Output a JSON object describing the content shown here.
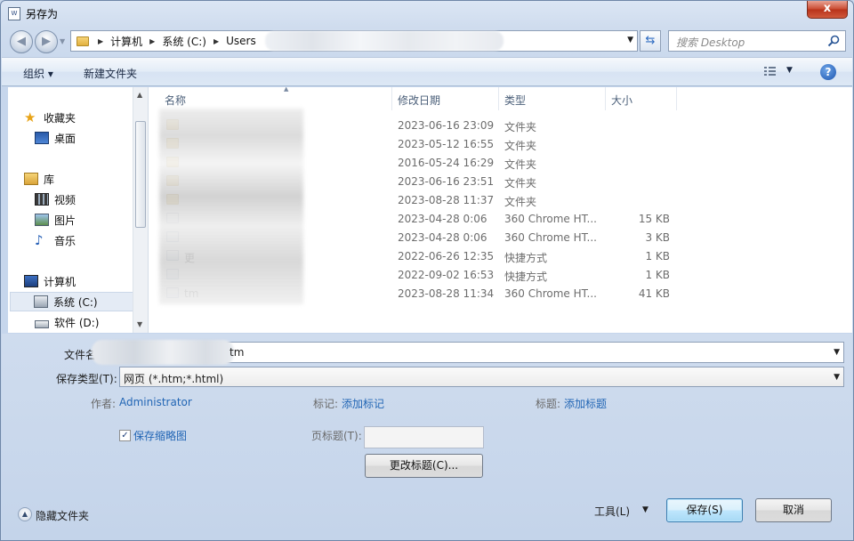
{
  "window": {
    "title": "另存为",
    "close_glyph": "x"
  },
  "address": {
    "crumbs": [
      "计算机",
      "系统 (C:)",
      "Users"
    ],
    "search_placeholder": "搜索 Desktop"
  },
  "toolbar": {
    "organize_label": "组织 ▾",
    "new_folder_label": "新建文件夹"
  },
  "nav": {
    "items": [
      {
        "label": "收藏夹",
        "icon": "star-icon"
      },
      {
        "label": "桌面",
        "icon": "desktop-icon"
      },
      {
        "label": "库",
        "icon": "library-icon"
      },
      {
        "label": "视频",
        "icon": "video-icon"
      },
      {
        "label": "图片",
        "icon": "picture-icon"
      },
      {
        "label": "音乐",
        "icon": "music-icon"
      },
      {
        "label": "计算机",
        "icon": "computer-icon"
      },
      {
        "label": "系统 (C:)",
        "icon": "drive-c-icon"
      },
      {
        "label": "软件 (D:)",
        "icon": "drive-d-icon"
      }
    ]
  },
  "files": {
    "columns": {
      "name": "名称",
      "date": "修改日期",
      "type": "类型",
      "size": "大小"
    },
    "rows": [
      {
        "name": "",
        "date": "2023-06-16 23:09",
        "type": "文件夹",
        "size": "",
        "icon": "folder-icon"
      },
      {
        "name": "",
        "date": "2023-05-12 16:55",
        "type": "文件夹",
        "size": "",
        "icon": "folder-icon"
      },
      {
        "name": "",
        "date": "2016-05-24 16:29",
        "type": "文件夹",
        "size": "",
        "icon": "folder-icon"
      },
      {
        "name": "",
        "date": "2023-06-16 23:51",
        "type": "文件夹",
        "size": "",
        "icon": "folder-icon"
      },
      {
        "name": "",
        "date": "2023-08-28 11:37",
        "type": "文件夹",
        "size": "",
        "icon": "folder-icon"
      },
      {
        "name": "",
        "date": "2023-04-28 0:06",
        "type": "360 Chrome HT...",
        "size": "15 KB",
        "icon": "html-file-icon"
      },
      {
        "name": "",
        "date": "2023-04-28 0:06",
        "type": "360 Chrome HT...",
        "size": "3 KB",
        "icon": "html-file-icon"
      },
      {
        "name": "更",
        "date": "2022-06-26 12:35",
        "type": "快捷方式",
        "size": "1 KB",
        "icon": "shortcut-icon"
      },
      {
        "name": "",
        "date": "2022-09-02 16:53",
        "type": "快捷方式",
        "size": "1 KB",
        "icon": "shortcut-icon"
      },
      {
        "name": "tm",
        "date": "2023-08-28 11:34",
        "type": "360 Chrome HT...",
        "size": "41 KB",
        "icon": "html-file-icon"
      }
    ]
  },
  "form": {
    "filename_label": "文件名",
    "filename_value": "tm",
    "savetype_label": "保存类型(T):",
    "savetype_value": "网页 (*.htm;*.html)",
    "author_label": "作者:",
    "author_value": "Administrator",
    "tags_label": "标记:",
    "tags_link": "添加标记",
    "title_label": "标题:",
    "title_link": "添加标题",
    "thumbnail_label": "保存缩略图",
    "thumbnail_checked": true,
    "page_title_label": "页标题(T):",
    "change_title_button": "更改标题(C)...",
    "hide_folders_label": "隐藏文件夹",
    "tools_label": "工具(L)",
    "save_button": "保存(S)",
    "cancel_button": "取消"
  }
}
